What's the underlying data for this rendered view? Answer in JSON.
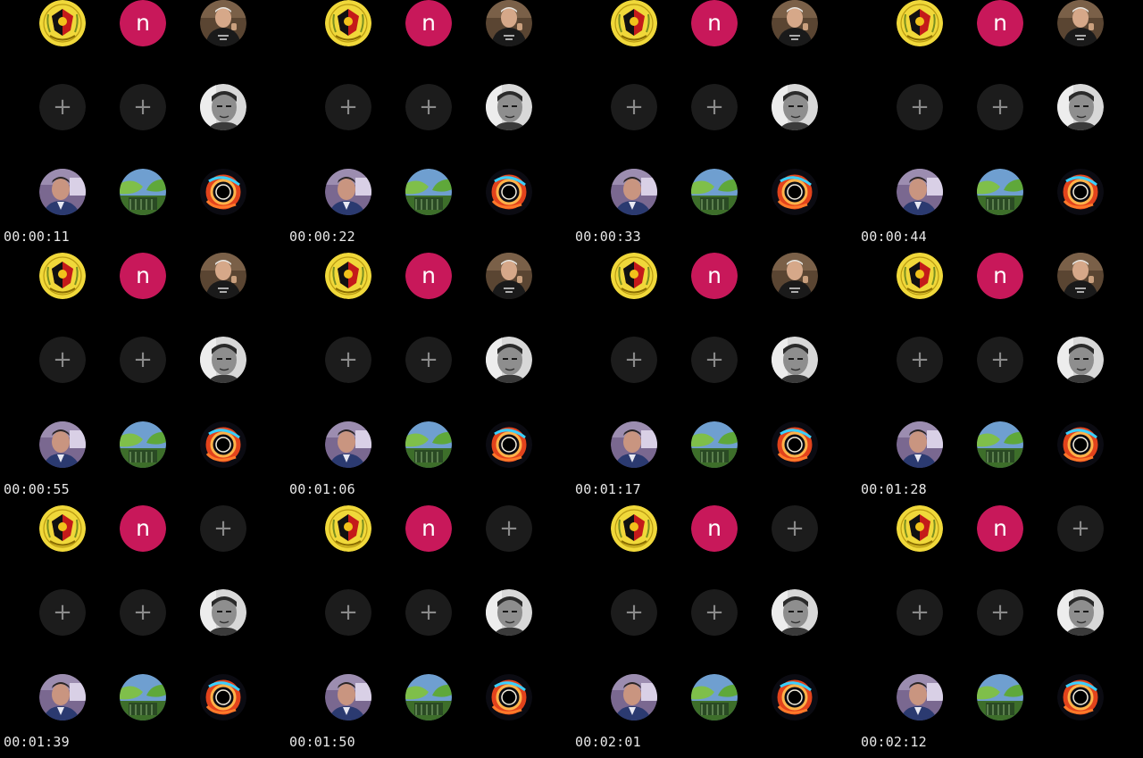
{
  "app": {
    "title": ""
  },
  "frames": [
    {
      "timestamp": "00:00:11",
      "tiles": [
        "crest-icon",
        "letter-n",
        "portrait-man-shirt",
        "add-tile",
        "add-tile",
        "portrait-man-gray",
        "portrait-man-car",
        "leaf-landscape",
        "cosmic-eye"
      ]
    },
    {
      "timestamp": "00:00:22",
      "tiles": [
        "crest-icon",
        "letter-n",
        "portrait-man-shirt",
        "add-tile",
        "add-tile",
        "portrait-man-gray",
        "portrait-man-car",
        "leaf-landscape",
        "cosmic-eye"
      ]
    },
    {
      "timestamp": "00:00:33",
      "tiles": [
        "crest-icon",
        "letter-n",
        "portrait-man-shirt",
        "add-tile",
        "add-tile",
        "portrait-man-gray",
        "portrait-man-car",
        "leaf-landscape",
        "cosmic-eye"
      ]
    },
    {
      "timestamp": "00:00:44",
      "tiles": [
        "crest-icon",
        "letter-n",
        "portrait-man-shirt",
        "add-tile",
        "add-tile",
        "portrait-man-gray",
        "portrait-man-car",
        "leaf-landscape",
        "cosmic-eye"
      ]
    },
    {
      "timestamp": "00:00:55",
      "tiles": [
        "crest-icon",
        "letter-n",
        "portrait-man-shirt",
        "add-tile",
        "add-tile",
        "portrait-man-gray",
        "portrait-man-car",
        "leaf-landscape",
        "cosmic-eye"
      ]
    },
    {
      "timestamp": "00:01:06",
      "tiles": [
        "crest-icon",
        "letter-n",
        "portrait-man-shirt",
        "add-tile",
        "add-tile",
        "portrait-man-gray",
        "portrait-man-car",
        "leaf-landscape",
        "cosmic-eye"
      ]
    },
    {
      "timestamp": "00:01:17",
      "tiles": [
        "crest-icon",
        "letter-n",
        "portrait-man-shirt",
        "add-tile",
        "add-tile",
        "portrait-man-gray",
        "portrait-man-car",
        "leaf-landscape",
        "cosmic-eye"
      ]
    },
    {
      "timestamp": "00:01:28",
      "tiles": [
        "crest-icon",
        "letter-n",
        "portrait-man-shirt",
        "add-tile",
        "add-tile",
        "portrait-man-gray",
        "portrait-man-car",
        "leaf-landscape",
        "cosmic-eye"
      ]
    },
    {
      "timestamp": "00:01:39",
      "tiles": [
        "crest-icon",
        "letter-n",
        "add-tile",
        "add-tile",
        "add-tile",
        "portrait-man-gray",
        "portrait-man-car",
        "leaf-landscape",
        "cosmic-eye"
      ]
    },
    {
      "timestamp": "00:01:50",
      "tiles": [
        "crest-icon",
        "letter-n",
        "add-tile",
        "add-tile",
        "add-tile",
        "portrait-man-gray",
        "portrait-man-car",
        "leaf-landscape",
        "cosmic-eye"
      ]
    },
    {
      "timestamp": "00:02:01",
      "tiles": [
        "crest-icon",
        "letter-n",
        "add-tile",
        "add-tile",
        "add-tile",
        "portrait-man-gray",
        "portrait-man-car",
        "leaf-landscape",
        "cosmic-eye"
      ]
    },
    {
      "timestamp": "00:02:12",
      "tiles": [
        "crest-icon",
        "letter-n",
        "add-tile",
        "add-tile",
        "add-tile",
        "portrait-man-gray",
        "portrait-man-car",
        "leaf-landscape",
        "cosmic-eye"
      ]
    }
  ],
  "labels": {
    "letter_n": "n",
    "add_symbol": "+"
  },
  "colors": {
    "background": "#000000",
    "add_tile": "#1c1c1c",
    "add_symbol": "#8a8a8a",
    "letter_tile": "#c8185a",
    "crest_yellow": "#f0d83a",
    "timestamp_text": "#e8e8e8"
  }
}
